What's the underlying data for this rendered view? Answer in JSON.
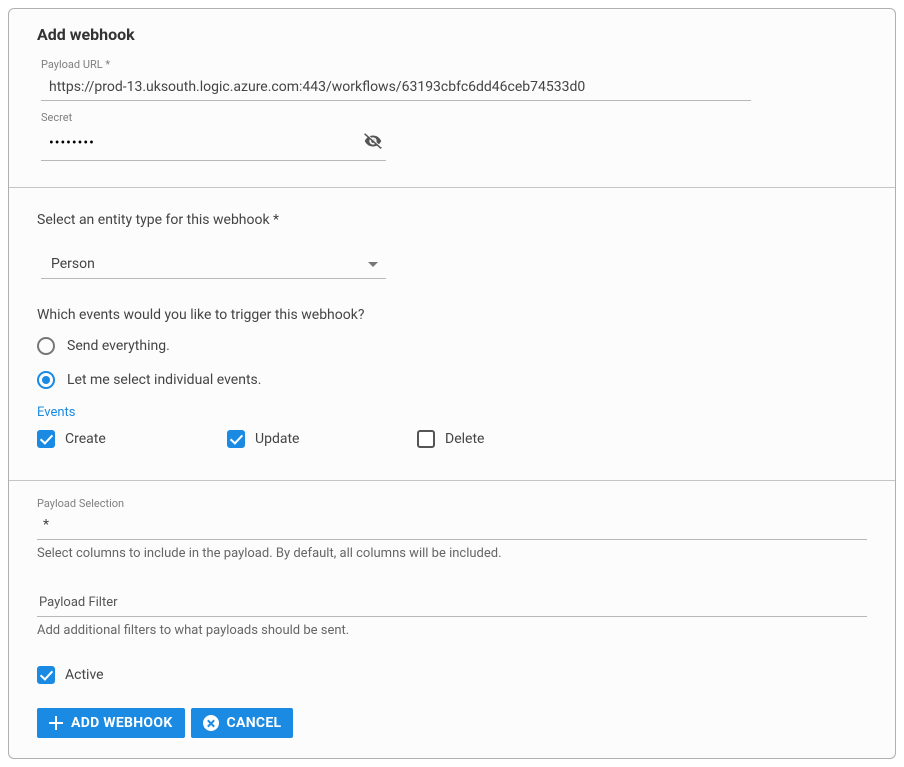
{
  "title": "Add webhook",
  "payload_url": {
    "label": "Payload URL *",
    "value": "https://prod-13.uksouth.logic.azure.com:443/workflows/63193cbfc6dd46ceb74533d0"
  },
  "secret": {
    "label": "Secret",
    "value": "••••••••"
  },
  "entity": {
    "label": "Select an entity type for this webhook *",
    "selected": "Person"
  },
  "events_question": "Which events would you like to trigger this webhook?",
  "radio_options": {
    "send_all": "Send everything.",
    "select_individual": "Let me select individual events."
  },
  "events_heading": "Events",
  "event_checks": {
    "create": "Create",
    "update": "Update",
    "delete": "Delete"
  },
  "payload_selection": {
    "label": "Payload Selection",
    "value": "*",
    "helper": "Select columns to include in the payload. By default, all columns will be included."
  },
  "payload_filter": {
    "label": "Payload Filter",
    "helper": "Add additional filters to what payloads should be sent."
  },
  "active_label": "Active",
  "buttons": {
    "add": "ADD WEBHOOK",
    "cancel": "CANCEL"
  }
}
